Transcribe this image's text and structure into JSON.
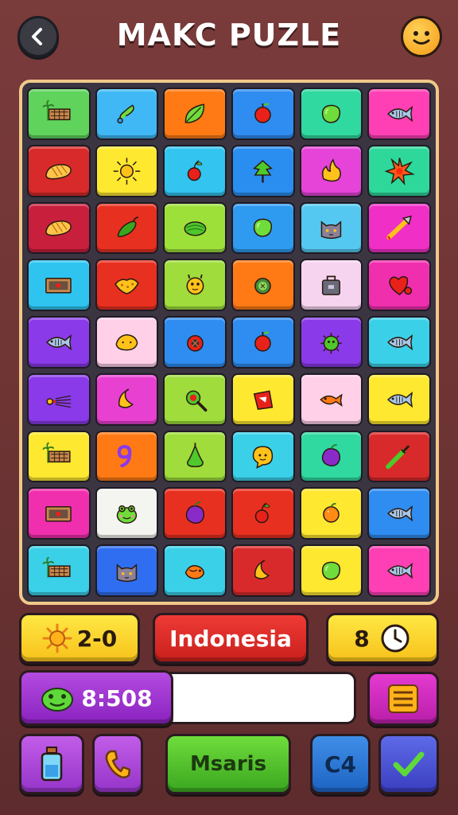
{
  "header": {
    "title": "MAKC PUZLE",
    "back_icon": "chevron-left-icon",
    "profile_icon": "smiley-face-icon"
  },
  "board": {
    "rows": [
      [
        {
          "icon": "palm-fence-icon",
          "color": "#5fd35c"
        },
        {
          "icon": "seed-drop-icon",
          "color": "#3fb8f5"
        },
        {
          "icon": "leaf-icon",
          "color": "#ff7a14"
        },
        {
          "icon": "apple-icon",
          "color": "#2f8cf0"
        },
        {
          "icon": "lime-icon",
          "color": "#30d9a0"
        },
        {
          "icon": "fish-icon",
          "color": "#ff3fb4"
        }
      ],
      [
        {
          "icon": "bread-loaf-icon",
          "color": "#d82a2a"
        },
        {
          "icon": "sun-icon",
          "color": "#ffe830"
        },
        {
          "icon": "cherry-icon",
          "color": "#33c4f0"
        },
        {
          "icon": "tree-icon",
          "color": "#2a8ef0"
        },
        {
          "icon": "flame-icon",
          "color": "#e644d8"
        },
        {
          "icon": "star-burst-icon",
          "color": "#2ed89a"
        }
      ],
      [
        {
          "icon": "bread-loaf-icon",
          "color": "#c81f3c"
        },
        {
          "icon": "chili-icon",
          "color": "#e83020"
        },
        {
          "icon": "melon-icon",
          "color": "#9ee03a"
        },
        {
          "icon": "lime-icon",
          "color": "#2e9bf0"
        },
        {
          "icon": "cat-face-icon",
          "color": "#54c8f0"
        },
        {
          "icon": "arrow-feather-icon",
          "color": "#f02fc6"
        }
      ],
      [
        {
          "icon": "sign-board-icon",
          "color": "#2fc4f0"
        },
        {
          "icon": "leaf-pastry-icon",
          "color": "#e83020"
        },
        {
          "icon": "monster-icon",
          "color": "#9fdc3c"
        },
        {
          "icon": "kiwi-icon",
          "color": "#ff7a14"
        },
        {
          "icon": "bag-icon",
          "color": "#f6d4f0"
        },
        {
          "icon": "heart-berry-icon",
          "color": "#f02fae"
        }
      ],
      [
        {
          "icon": "fish-icon",
          "color": "#8a3ae8"
        },
        {
          "icon": "pastry-icon",
          "color": "#ffd0e8"
        },
        {
          "icon": "tomato-slice-icon",
          "color": "#2f8cf0"
        },
        {
          "icon": "apple-icon",
          "color": "#2f8cf0"
        },
        {
          "icon": "germ-icon",
          "color": "#8a3ae8"
        },
        {
          "icon": "fish-icon",
          "color": "#3ad0e8"
        }
      ],
      [
        {
          "icon": "brush-icon",
          "color": "#8a3ae8"
        },
        {
          "icon": "banana-icon",
          "color": "#e840d0"
        },
        {
          "icon": "magnifier-icon",
          "color": "#9fdc3c"
        },
        {
          "icon": "pouch-icon",
          "color": "#ffe830"
        },
        {
          "icon": "goldfish-icon",
          "color": "#ffd0e8"
        },
        {
          "icon": "fish-icon",
          "color": "#ffe830"
        }
      ],
      [
        {
          "icon": "palm-fence-icon",
          "color": "#ffe830"
        },
        {
          "icon": "number-nine-icon",
          "color": "#ff7a14"
        },
        {
          "icon": "pear-icon",
          "color": "#9fdc3c"
        },
        {
          "icon": "speech-face-icon",
          "color": "#3ad0e8"
        },
        {
          "icon": "plum-icon",
          "color": "#30d9a0"
        },
        {
          "icon": "knife-icon",
          "color": "#d82a2a"
        }
      ],
      [
        {
          "icon": "sign-board-icon",
          "color": "#f02fae"
        },
        {
          "icon": "frog-face-icon",
          "color": "#f4f4f0"
        },
        {
          "icon": "plum-icon",
          "color": "#e83020"
        },
        {
          "icon": "cherry-icon",
          "color": "#e83020"
        },
        {
          "icon": "orange-icon",
          "color": "#ffe830"
        },
        {
          "icon": "fish-icon",
          "color": "#2f8cf0"
        }
      ],
      [
        {
          "icon": "palm-fence-icon",
          "color": "#3ad0e8"
        },
        {
          "icon": "cat-face-icon",
          "color": "#2f6ef0"
        },
        {
          "icon": "bird-icon",
          "color": "#3ad0e8"
        },
        {
          "icon": "banana-icon",
          "color": "#d82a2a"
        },
        {
          "icon": "lime-icon",
          "color": "#ffe830"
        },
        {
          "icon": "fish-icon",
          "color": "#ff3fb4"
        }
      ]
    ]
  },
  "stats": {
    "score_value": "2-0",
    "score_icon": "sun-icon",
    "country_label": "Indonesia",
    "timer_value": "8",
    "timer_icon": "clock-icon"
  },
  "progress": {
    "value_text": "8:508",
    "icon": "frog-face-icon",
    "menu_icon": "list-icon"
  },
  "actions": {
    "bottle_icon": "bottle-icon",
    "phone_icon": "phone-icon",
    "main_label": "Msaris",
    "count_label": "C4",
    "confirm_icon": "check-icon"
  }
}
